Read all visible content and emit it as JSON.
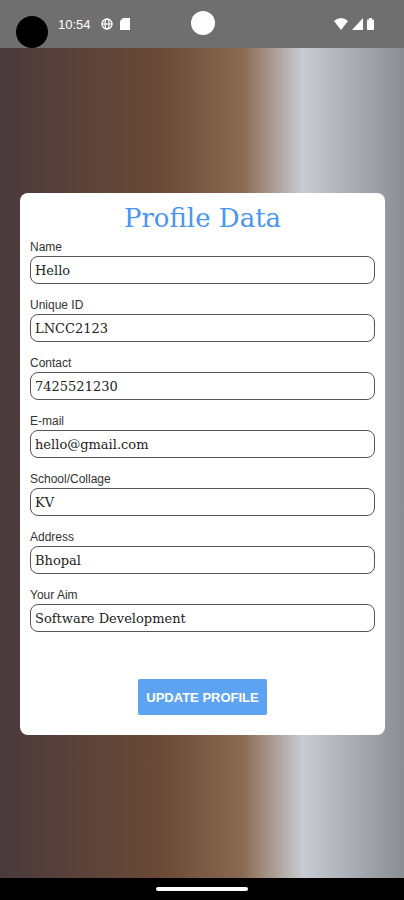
{
  "status_bar": {
    "time": "10:54"
  },
  "card": {
    "title": "Profile Data",
    "fields": [
      {
        "label": "Name",
        "value": "Hello"
      },
      {
        "label": "Unique ID",
        "value": "LNCC2123"
      },
      {
        "label": "Contact",
        "value": "7425521230"
      },
      {
        "label": "E-mail",
        "value": "hello@gmail.com"
      },
      {
        "label": "School/Collage",
        "value": "KV"
      },
      {
        "label": "Address",
        "value": "Bhopal"
      },
      {
        "label": "Your Aim",
        "value": "Software Development"
      }
    ],
    "button": "UPDATE PROFILE"
  }
}
